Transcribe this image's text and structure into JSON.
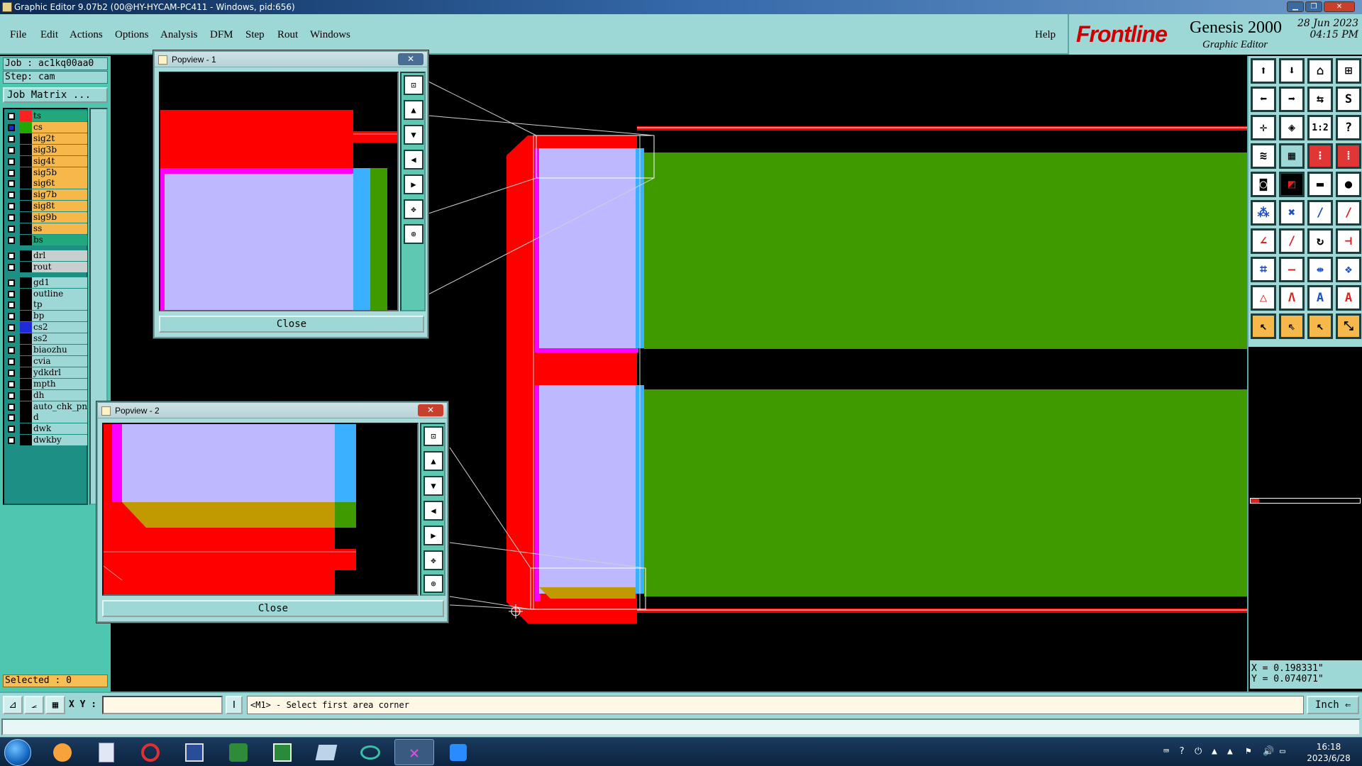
{
  "window": {
    "title": "Graphic Editor 9.07b2 (00@HY-HYCAM-PC411 - Windows, pid:656)"
  },
  "menu": {
    "file": "File",
    "edit": "Edit",
    "actions": "Actions",
    "options": "Options",
    "analysis": "Analysis",
    "dfm": "DFM",
    "step": "Step",
    "rout": "Rout",
    "windows": "Windows",
    "help": "Help"
  },
  "logo": {
    "brand": "Frontline",
    "product": "Genesis 2000",
    "subtitle": "Graphic Editor",
    "date": "28 Jun 2023",
    "time": "04:15 PM"
  },
  "left": {
    "job": "Job : ac1kq00aa0",
    "step": "Step: cam",
    "job_matrix": "Job Matrix ...",
    "selected": "Selected : 0"
  },
  "layers": [
    {
      "name": "ts",
      "color": "#ff2020",
      "bg": "#23a87d",
      "checked": false
    },
    {
      "name": "cs",
      "color": "#23a800",
      "bg": "#f6b84a",
      "checked": true,
      "marker": "="
    },
    {
      "name": "sig2t",
      "color": "#000000",
      "bg": "#f6b84a",
      "checked": false
    },
    {
      "name": "sig3b",
      "color": "#000000",
      "bg": "#f6b84a",
      "checked": false
    },
    {
      "name": "sig4t",
      "color": "#000000",
      "bg": "#f6b84a",
      "checked": false
    },
    {
      "name": "sig5b",
      "color": "#000000",
      "bg": "#f6b84a",
      "checked": false
    },
    {
      "name": "sig6t",
      "color": "#000000",
      "bg": "#f6b84a",
      "checked": false
    },
    {
      "name": "sig7b",
      "color": "#000000",
      "bg": "#f6b84a",
      "checked": false
    },
    {
      "name": "sig8t",
      "color": "#000000",
      "bg": "#f6b84a",
      "checked": false
    },
    {
      "name": "sig9b",
      "color": "#000000",
      "bg": "#f6b84a",
      "checked": false
    },
    {
      "name": "ss",
      "color": "#000000",
      "bg": "#f6b84a",
      "checked": false
    },
    {
      "name": "bs",
      "color": "#000000",
      "bg": "#23a87d",
      "checked": false
    },
    {
      "name": "drl",
      "color": "#000000",
      "bg": "#c8cfcf",
      "checked": false
    },
    {
      "name": "rout",
      "color": "#000000",
      "bg": "#c8cfcf",
      "checked": false
    },
    {
      "name": "gd1",
      "color": "#000000",
      "bg": "#9dd8d6",
      "checked": false
    },
    {
      "name": "outline",
      "color": "#000000",
      "bg": "#9dd8d6",
      "checked": false
    },
    {
      "name": "tp",
      "color": "#000000",
      "bg": "#9dd8d6",
      "checked": false
    },
    {
      "name": "bp",
      "color": "#000000",
      "bg": "#9dd8d6",
      "checked": false
    },
    {
      "name": "cs2",
      "color": "#1f2bd8",
      "bg": "#9dd8d6",
      "checked": false
    },
    {
      "name": "ss2",
      "color": "#000000",
      "bg": "#9dd8d6",
      "checked": false
    },
    {
      "name": "biaozhu",
      "color": "#000000",
      "bg": "#9dd8d6",
      "checked": false
    },
    {
      "name": "cvia",
      "color": "#000000",
      "bg": "#9dd8d6",
      "checked": false
    },
    {
      "name": "ydkdrl",
      "color": "#000000",
      "bg": "#9dd8d6",
      "checked": false
    },
    {
      "name": "mpth",
      "color": "#000000",
      "bg": "#9dd8d6",
      "checked": false
    },
    {
      "name": "dh",
      "color": "#000000",
      "bg": "#9dd8d6",
      "checked": false
    },
    {
      "name": "auto_chk_pn",
      "color": "#000000",
      "bg": "#9dd8d6",
      "checked": false
    },
    {
      "name": "d",
      "color": "#000000",
      "bg": "#9dd8d6",
      "checked": false
    },
    {
      "name": "dwk",
      "color": "#000000",
      "bg": "#9dd8d6",
      "checked": false
    },
    {
      "name": "dwkby",
      "color": "#000000",
      "bg": "#9dd8d6",
      "checked": false
    }
  ],
  "popview1": {
    "title": "Popview - 1",
    "close": "Close"
  },
  "popview2": {
    "title": "Popview - 2",
    "close": "Close"
  },
  "coords": {
    "x": "X = 0.198331\"",
    "y": "Y = 0.074071\""
  },
  "bottom": {
    "xy_label": "X Y :",
    "xy_value": "",
    "prompt": "<M1> - Select first area corner",
    "units": "Inch ⇐"
  },
  "taskbar": {
    "time": "16:18",
    "date": "2023/6/28"
  },
  "colors": {
    "copper_red": "#ff0000",
    "green": "#3f9a00",
    "lavender": "#bdb8ff",
    "cyan": "#3ab0ff",
    "magenta": "#ff00ff",
    "gold": "#c09a00",
    "panel_teal": "#9dd8d6"
  }
}
